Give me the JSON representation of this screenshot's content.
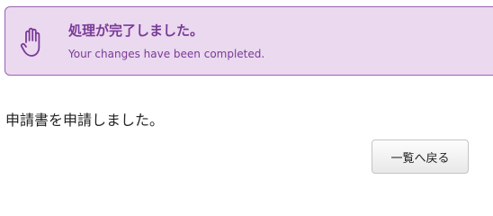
{
  "notice": {
    "icon": "hand-stop-icon",
    "title": "処理が完了しました。",
    "subtitle": "Your changes have been completed.",
    "background_color": "#ead9ef",
    "border_color": "#9b62b5",
    "text_color": "#7a3a98"
  },
  "main": {
    "message": "申請書を申請しました。"
  },
  "actions": {
    "back_label": "一覧へ戻る"
  }
}
